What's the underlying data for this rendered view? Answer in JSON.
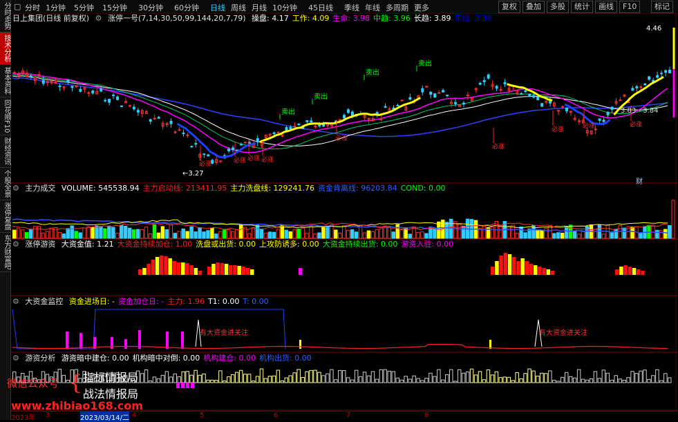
{
  "sidebar": {
    "tabs": [
      {
        "label": "分时走势",
        "active": false
      },
      {
        "label": "技术分析",
        "active": true
      },
      {
        "label": "基本资料",
        "active": false
      },
      {
        "label": "同花顺F10",
        "active": false
      },
      {
        "label": "财经资讯",
        "active": false
      },
      {
        "label": "个股全景",
        "active": false
      },
      {
        "label": "涨停复盘",
        "active": false
      },
      {
        "label": "东方财富吧",
        "active": false
      }
    ]
  },
  "toolbar": {
    "menu_icon": "▢",
    "periods": [
      "分时",
      "1分钟",
      "5分钟",
      "15分钟",
      "30分钟",
      "60分钟",
      "日线",
      "周线",
      "月线",
      "10分钟",
      "45日线",
      "季线",
      "年线",
      "多周期",
      "更多"
    ],
    "active_period": "日线",
    "right_buttons": [
      "复权",
      "叠加",
      "多股",
      "统计",
      "画线",
      "F10",
      "标记"
    ]
  },
  "main_panel": {
    "stock": "日上集团(日线 前复权)",
    "indicator": "涨停一号(7,14,30,50,99,144,20,7,79)",
    "legend": [
      {
        "label": "操盘",
        "value": "4.17",
        "color": "#ffffff"
      },
      {
        "label": "工作",
        "value": "4.09",
        "color": "#ffff00"
      },
      {
        "label": "生命",
        "value": "3.98",
        "color": "#ff00ff"
      },
      {
        "label": "中趋",
        "value": "3.96",
        "color": "#00ff00"
      },
      {
        "label": "长趋",
        "value": "3.89",
        "color": "#ffffff"
      },
      {
        "label": "年线",
        "value": "3.38",
        "color": "#0000ff"
      }
    ],
    "price_high": "4.46",
    "price_low": "3.27",
    "range_text": "3.83 - 3.84",
    "sell_label": "卖出",
    "cai_label": "财",
    "zhang_label": "必涨"
  },
  "volume_panel": {
    "title": "主力成交",
    "items": [
      {
        "label": "VOLUME",
        "value": "545538.94",
        "color": "#ffffff"
      },
      {
        "label": "主力启动线",
        "value": "213411.95",
        "color": "#ff2020"
      },
      {
        "label": "主力洗盘线",
        "value": "129241.76",
        "color": "#ffff00"
      },
      {
        "label": "资金背离线",
        "value": "96203.84",
        "color": "#3060ff"
      },
      {
        "label": "COND",
        "value": "0.00",
        "color": "#00ff00"
      }
    ]
  },
  "zt_panel": {
    "title": "涨停游资",
    "items": [
      {
        "label": "大资金值",
        "value": "1.21",
        "color": "#ffffff"
      },
      {
        "label": "大资金持续加仓",
        "value": "1.00",
        "color": "#ff2020"
      },
      {
        "label": "洗盘或出货",
        "value": "0.00",
        "color": "#ffff00"
      },
      {
        "label": "上攻防诱多",
        "value": "0.00",
        "color": "#ffff00"
      },
      {
        "label": "大资金持续出货",
        "value": "0.00",
        "color": "#00ff00"
      },
      {
        "label": "游资入驻",
        "value": "0.00",
        "color": "#ff00ff"
      }
    ]
  },
  "monitor_panel": {
    "title": "大资金监控",
    "items": [
      {
        "label": "资金进场日",
        "value": "-",
        "color": "#ffff00"
      },
      {
        "label": "资金加仓日",
        "value": "-",
        "color": "#ff00ff"
      },
      {
        "label": "主力",
        "value": "1.96",
        "color": "#ff2020"
      },
      {
        "label": "T1",
        "value": "0.00",
        "color": "#ffffff"
      },
      {
        "label": "T",
        "value": "0.00",
        "color": "#3060ff"
      }
    ],
    "note": "有大资金进关注"
  },
  "youzi_panel": {
    "title": "游资分析",
    "items": [
      {
        "label": "游资暗中建仓",
        "value": "0.00",
        "color": "#ffffff"
      },
      {
        "label": "机构暗中对倒",
        "value": "0.00",
        "color": "#ffffff"
      },
      {
        "label": "机构建仓",
        "value": "0.00",
        "color": "#ff00ff"
      },
      {
        "label": "机构出货",
        "value": "0.00",
        "color": "#3060ff"
      }
    ]
  },
  "watermark": {
    "wechat": "微信公众号",
    "name1": "指标情报局",
    "name2": "战法情报局",
    "site": "www.zhibiao168.com"
  },
  "date_axis": {
    "labels": [
      "2023年",
      "3",
      "2023/03/14/二",
      "4",
      "5",
      "6",
      "7",
      "8"
    ]
  }
}
